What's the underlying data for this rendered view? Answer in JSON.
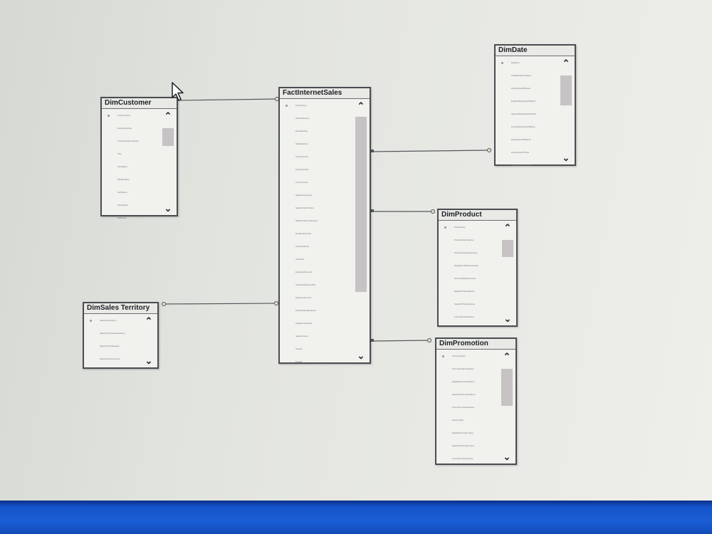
{
  "tables": [
    {
      "name": "DimCustomer",
      "columns": [
        "CustomerKey",
        "GeographyKey",
        "CustomerAlternateKey",
        "Title",
        "FirstName",
        "MiddleName",
        "LastName",
        "NameStyle",
        "BirthDate"
      ]
    },
    {
      "name": "FactInternetSales",
      "columns": [
        "ProductKey",
        "OrderDateKey",
        "DueDateKey",
        "ShipDateKey",
        "CustomerKey",
        "PromotionKey",
        "CurrencyKey",
        "SalesTerritoryKey",
        "SalesOrderNumber",
        "SalesOrderLineNumber",
        "RevisionNumber",
        "OrderQuantity",
        "UnitPrice",
        "ExtendedAmount",
        "UnitPriceDiscountPct",
        "DiscountAmount",
        "ProductStandardCost",
        "TotalProductCost",
        "SalesAmount",
        "TaxAmt",
        "Freight"
      ]
    },
    {
      "name": "DimDate",
      "columns": [
        "DateKey",
        "FullDateAlternateKey",
        "DayNumberOfWeek",
        "EnglishDayNameOfWeek",
        "SpanishDayNameOfWeek",
        "FrenchDayNameOfWeek",
        "DayNumberOfMonth",
        "DayNumberOfYear",
        "WeekNumberOfYear"
      ]
    },
    {
      "name": "DimProduct",
      "columns": [
        "ProductKey",
        "ProductAlternateKey",
        "ProductSubcategoryKey",
        "WeightUnitMeasureCode",
        "SizeUnitMeasureCode",
        "EnglishProductName",
        "SpanishProductName",
        "FrenchProductName"
      ]
    },
    {
      "name": "DimSales Territory",
      "columns": [
        "SalesTerritoryKey",
        "SalesTerritoryAlternateKey",
        "SalesTerritoryRegion",
        "SalesTerritoryCountry"
      ]
    },
    {
      "name": "DimPromotion",
      "columns": [
        "PromotionKey",
        "PromotionAlternateKey",
        "EnglishPromotionName",
        "SpanishPromotionName",
        "FrenchPromotionName",
        "DiscountPct",
        "EnglishPromotionType",
        "SpanishPromotionType",
        "FrenchPromotionType"
      ]
    }
  ],
  "scrollbar": {
    "up_glyph": "⌃",
    "down_glyph": "⌄"
  }
}
